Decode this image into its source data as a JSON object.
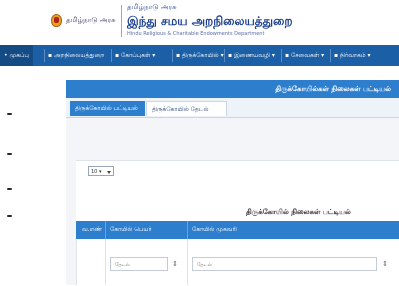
{
  "header": {
    "govt_label": "தமிழ்நாடு அரசு",
    "dept_sub": "தமிழ்நாடு அரசு",
    "dept_main": "இந்து சமய அறநிலையத்துறை",
    "dept_sub2": "Hindu Religious & Charitable Endowments Department"
  },
  "nav": {
    "items": [
      {
        "label": "• முகப்பு",
        "active": true
      },
      {
        "label": "▪ அறநிலையத்துறை"
      },
      {
        "label": "▪ கோப்புகள் ▾"
      },
      {
        "label": "▪ திருக்கோயில் ▾"
      },
      {
        "label": "▪ இணையவழி ▾"
      },
      {
        "label": "▪ சேவைகள் ▾"
      },
      {
        "label": "▪ நிர்வாகம் ▾"
      }
    ]
  },
  "panel": {
    "title": "திருக்கோயில்கள் நிலைகள் பட்டியல்",
    "tabs": [
      "திருக்கோயில் பட்டியல்",
      "திருக்கோயில் தேடல்"
    ]
  },
  "page_size": {
    "value": "10 ▾"
  },
  "sub_title": "திருக்கோயில் நிலைகள் பட்டியல்",
  "table": {
    "headers": [
      "வ.எண்",
      "கோயில் பெயர்",
      "கோயில் முகவரி"
    ],
    "filters": [
      {
        "placeholder": "தேடல்",
        "sort": "⇕"
      },
      {
        "placeholder": "தேடல்",
        "sort": "⇕"
      }
    ]
  }
}
